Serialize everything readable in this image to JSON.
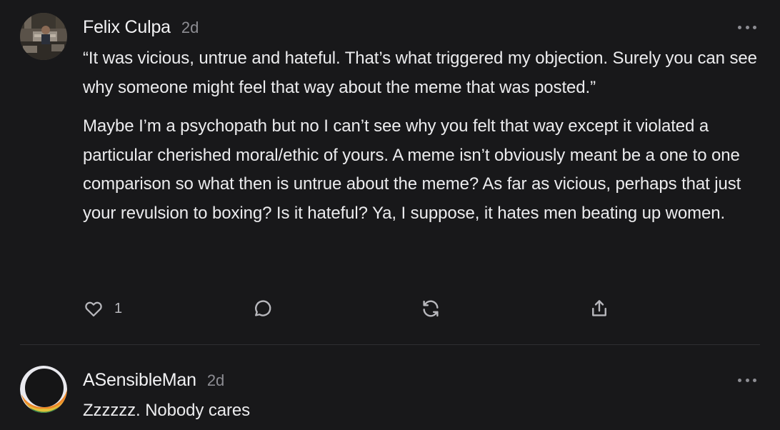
{
  "comments": [
    {
      "author": "Felix Culpa",
      "time": "2d",
      "paragraphs": [
        "“It was vicious, untrue and hateful. That’s what triggered my objection. Surely you can see why someone might feel that way about the meme that was posted.”",
        "Maybe I’m a psychopath but no I can’t see why you felt that way except it violated a particular cherished moral/ethic of yours. A meme isn’t obviously meant be a one to one comparison so what then is untrue about the meme? As far as vicious, perhaps that just your revulsion to boxing? Is it hateful? Ya, I suppose, it hates men beating up women."
      ],
      "like_count": "1",
      "icons": [
        "heart-icon",
        "comment-bubble-icon",
        "restack-icon",
        "share-icon",
        "more-icon"
      ]
    },
    {
      "author": "ASensibleMan",
      "time": "2d",
      "text": "Zzzzzz. Nobody cares",
      "icons": [
        "more-icon"
      ]
    }
  ],
  "colors": {
    "background": "#18181a",
    "text": "#ececee",
    "muted": "#8d8d93",
    "icon": "#b8b8bd",
    "divider": "#2e2e31"
  }
}
